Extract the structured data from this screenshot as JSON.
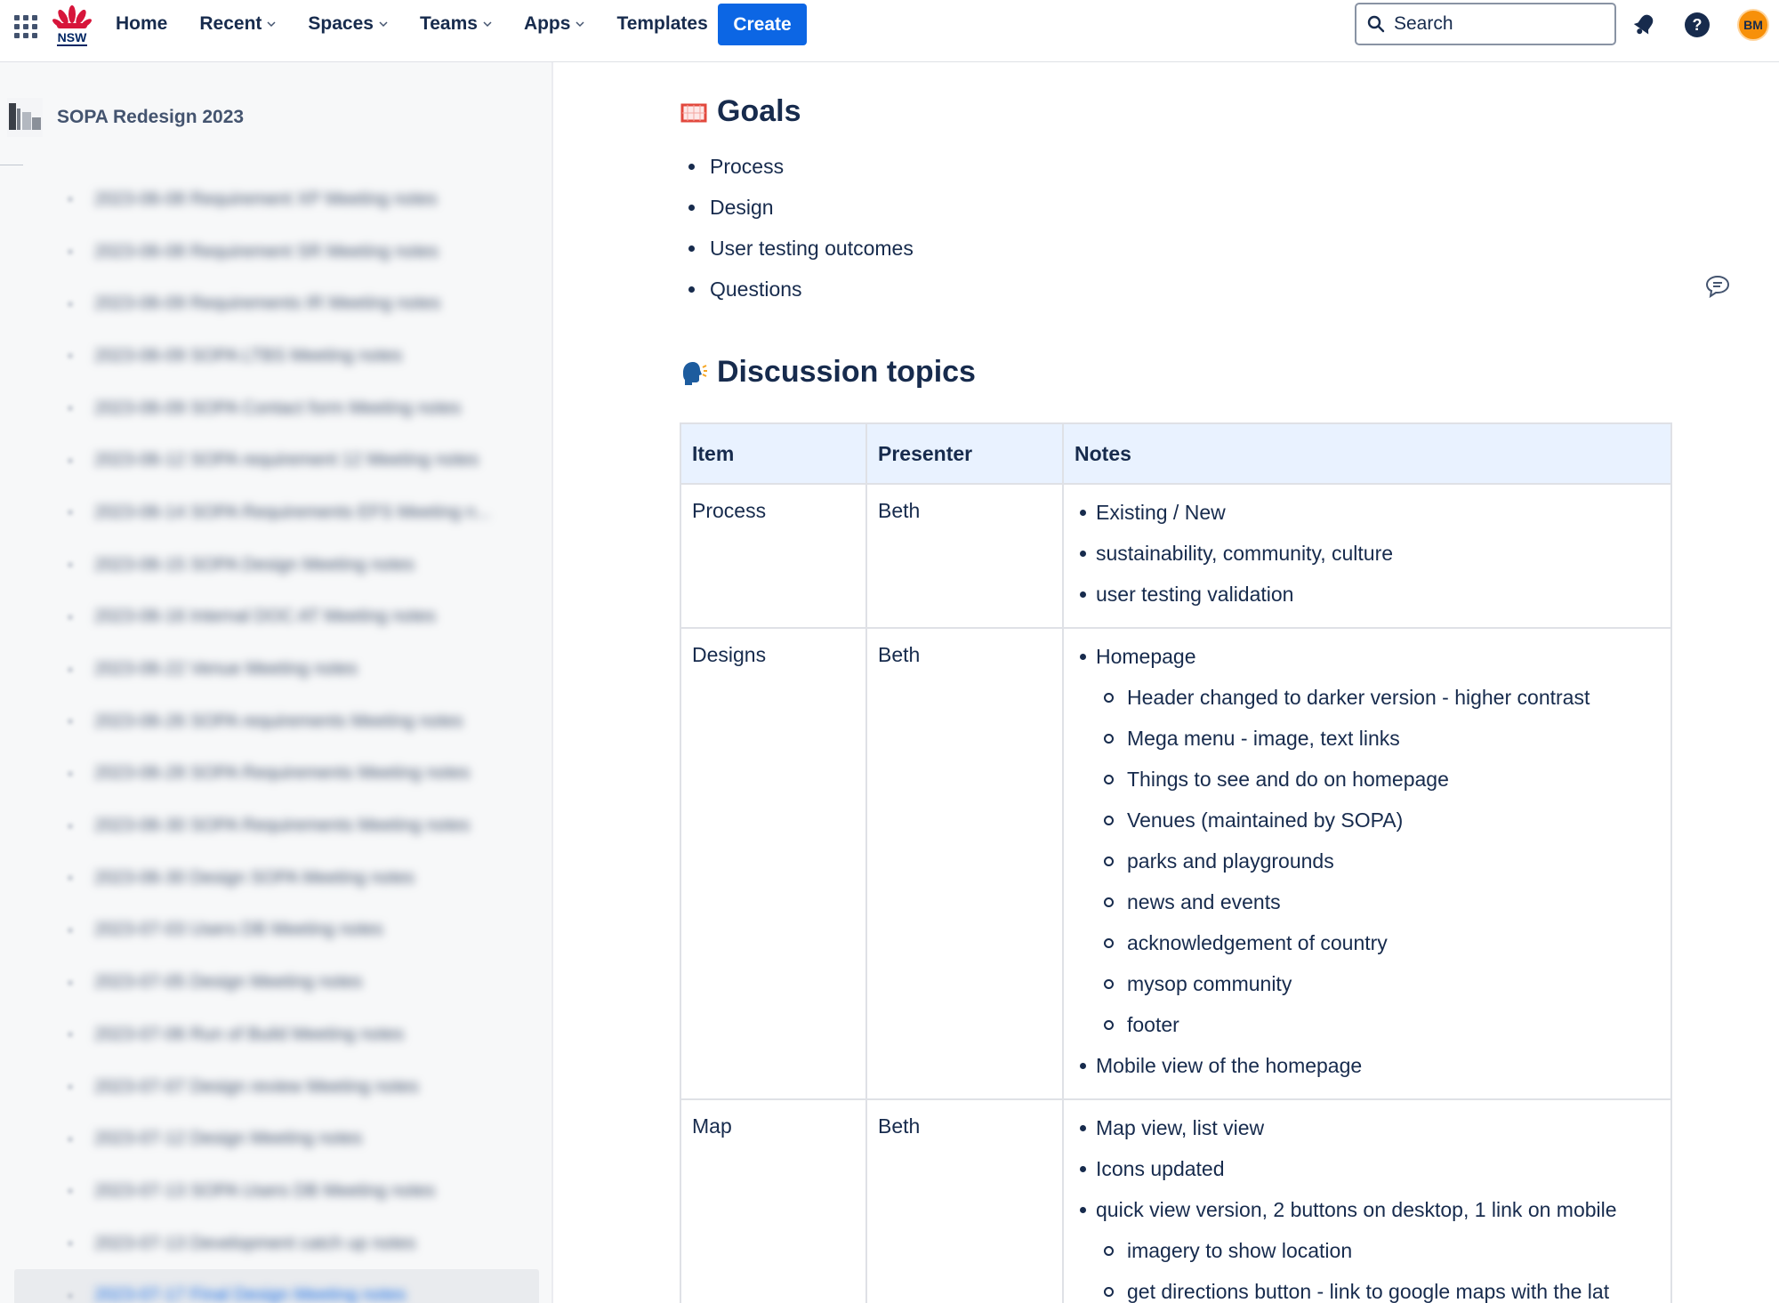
{
  "topbar": {
    "nav": [
      {
        "label": "Home",
        "dropdown": false
      },
      {
        "label": "Recent",
        "dropdown": true
      },
      {
        "label": "Spaces",
        "dropdown": true
      },
      {
        "label": "Teams",
        "dropdown": true
      },
      {
        "label": "Apps",
        "dropdown": true
      },
      {
        "label": "Templates",
        "dropdown": false
      }
    ],
    "create_label": "Create",
    "search_placeholder": "Search",
    "avatar_initials": "BM",
    "accent_color": "#0c66e4",
    "avatar_color": "#f79009"
  },
  "sidebar": {
    "space_name": "SOPA Redesign 2023",
    "tree_items": [
      {
        "label": "2023-06-08 Requirement XP Meeting notes",
        "selected": false
      },
      {
        "label": "2023-06-08 Requirement SR Meeting notes",
        "selected": false
      },
      {
        "label": "2023-06-09 Requirements IR Meeting notes",
        "selected": false
      },
      {
        "label": "2023-06-09 SOPA LTBS Meeting notes",
        "selected": false
      },
      {
        "label": "2023-06-09 SOPA Contact form Meeting notes",
        "selected": false
      },
      {
        "label": "2023-06-12 SOPA requirement 12 Meeting notes",
        "selected": false
      },
      {
        "label": "2023-06-14 SOPA Requirements EFS Meeting n...",
        "selected": false
      },
      {
        "label": "2023-06-15 SOPA Design Meeting notes",
        "selected": false
      },
      {
        "label": "2023-06-16 Internal DOC AT Meeting notes",
        "selected": false
      },
      {
        "label": "2023-06-22 Venue Meeting notes",
        "selected": false
      },
      {
        "label": "2023-06-26 SOPA requirements Meeting notes",
        "selected": false
      },
      {
        "label": "2023-06-28 SOPA Requirements Meeting notes",
        "selected": false
      },
      {
        "label": "2023-06-30 SOPA Requirements Meeting notes",
        "selected": false
      },
      {
        "label": "2023-06-30 Design SOPA Meeting notes",
        "selected": false
      },
      {
        "label": "2023-07-03 Users DB Meeting notes",
        "selected": false
      },
      {
        "label": "2023-07-05 Design Meeting notes",
        "selected": false
      },
      {
        "label": "2023-07-06 Run of Build Meeting notes",
        "selected": false
      },
      {
        "label": "2023-07-07 Design review Meeting notes",
        "selected": false
      },
      {
        "label": "2023-07-12 Design Meeting notes",
        "selected": false
      },
      {
        "label": "2023-07-13 SOPA Users DB Meeting notes",
        "selected": false
      },
      {
        "label": "2023-07-13 Development catch up notes",
        "selected": false
      },
      {
        "label": "2023-07-17 Final Design Meeting notes",
        "selected": true
      }
    ]
  },
  "content": {
    "goals_heading": "Goals",
    "goals": [
      "Process",
      "Design",
      "User testing outcomes",
      "Questions"
    ],
    "discussion_heading": "Discussion topics",
    "table": {
      "headers": [
        "Item",
        "Presenter",
        "Notes"
      ],
      "header_bg": "#e9f2ff",
      "rows": [
        {
          "item": "Process",
          "presenter": "Beth",
          "notes": [
            {
              "text": "Existing / New",
              "sub": []
            },
            {
              "text": "sustainability, community, culture",
              "sub": []
            },
            {
              "text": "user testing validation",
              "sub": []
            }
          ]
        },
        {
          "item": "Designs",
          "presenter": "Beth",
          "notes": [
            {
              "text": "Homepage",
              "sub": [
                "Header changed to darker version - higher contrast",
                "Mega menu - image, text links",
                "Things to see and do on homepage",
                "Venues (maintained by SOPA)",
                "parks and playgrounds",
                "news and events",
                "acknowledgement of country",
                "mysop community",
                "footer"
              ]
            },
            {
              "text": "Mobile view of the homepage",
              "sub": []
            }
          ]
        },
        {
          "item": "Map",
          "presenter": "Beth",
          "notes": [
            {
              "text": "Map view, list view",
              "sub": []
            },
            {
              "text": "Icons updated",
              "sub": []
            },
            {
              "text": "quick view version, 2 buttons on desktop, 1 link on mobile",
              "sub": [
                "imagery to show location",
                "get directions button - link to google maps with the lat"
              ]
            }
          ]
        }
      ]
    }
  }
}
